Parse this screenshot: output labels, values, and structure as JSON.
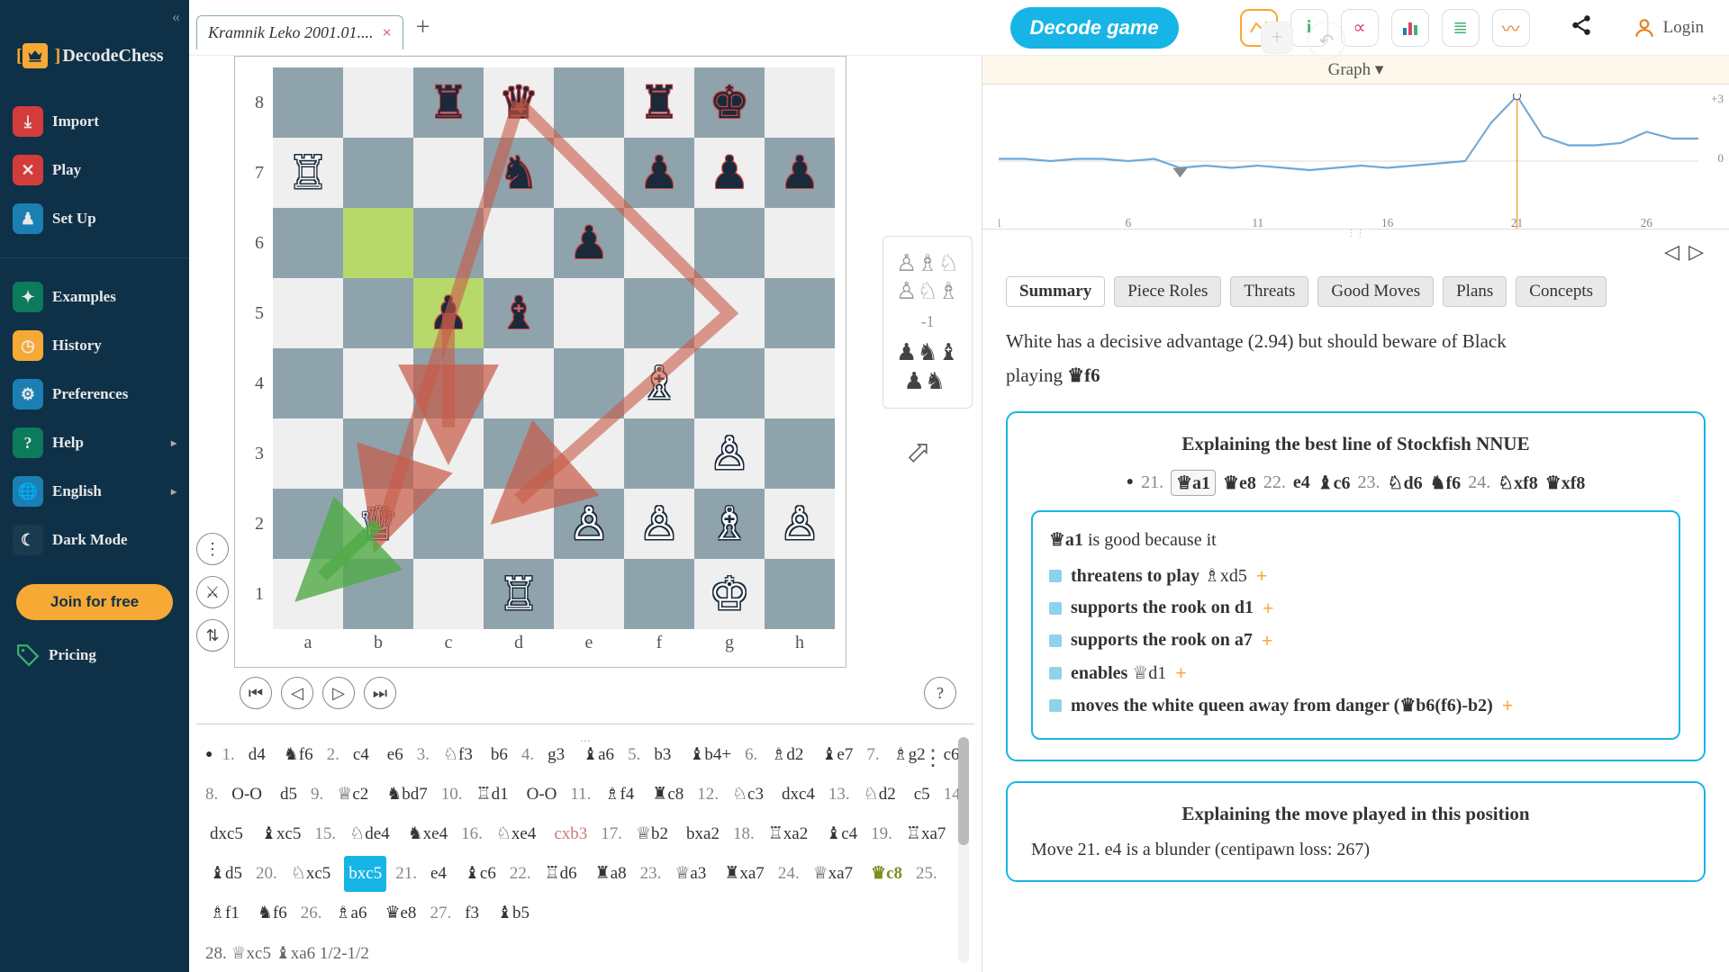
{
  "brand": "DecodeChess",
  "sidebar": {
    "import": "Import",
    "play": "Play",
    "setup": "Set Up",
    "examples": "Examples",
    "history": "History",
    "preferences": "Preferences",
    "help": "Help",
    "language": "English",
    "darkmode": "Dark Mode",
    "join": "Join for free",
    "pricing": "Pricing"
  },
  "tab_title": "Kramnik Leko 2001.01....",
  "decode_label": "Decode game",
  "login_label": "Login",
  "captured_score": "-1",
  "graph": {
    "title": "Graph ▾"
  },
  "chart_data": {
    "type": "line",
    "xlabel": "",
    "ylabel": "",
    "x_ticks": [
      "1",
      "6",
      "11",
      "16",
      "21",
      "26"
    ],
    "ylim": [
      -3,
      3
    ],
    "x": [
      1,
      2,
      3,
      4,
      5,
      6,
      7,
      8,
      9,
      10,
      11,
      12,
      13,
      14,
      15,
      16,
      17,
      18,
      19,
      20,
      21,
      22,
      23,
      24,
      25,
      26,
      27,
      28
    ],
    "values": [
      0.1,
      0.1,
      0.0,
      0.1,
      0.1,
      0.0,
      0.1,
      -0.3,
      -0.2,
      -0.3,
      -0.2,
      -0.3,
      -0.4,
      -0.3,
      -0.2,
      -0.3,
      -0.2,
      -0.1,
      0.0,
      1.7,
      2.9,
      1.1,
      0.7,
      0.7,
      0.8,
      1.3,
      1.0,
      1.0
    ],
    "marker_x": 21,
    "marker_y": 2.9
  },
  "tabs": [
    "Summary",
    "Piece Roles",
    "Threats",
    "Good Moves",
    "Plans",
    "Concepts"
  ],
  "summary_line1": "White has a decisive advantage (2.94) but should beware of Black",
  "summary_line2_a": "playing ",
  "summary_line2_b": "♛f6",
  "best_card_title": "Explaining the best line of Stockfish NNUE",
  "bestline": [
    {
      "n": "21.",
      "m": "♕a1",
      "boxed": true
    },
    {
      "m": "♛e8"
    },
    {
      "n": "22.",
      "m": "e4"
    },
    {
      "m": "♝c6"
    },
    {
      "n": "23.",
      "m": "♘d6"
    },
    {
      "m": "♞f6"
    },
    {
      "n": "24.",
      "m": "♘xf8"
    },
    {
      "m": "♛xf8"
    }
  ],
  "reason_head_a": "♕a1",
  "reason_head_b": " is good because it",
  "reasons": [
    {
      "t": "threatens to play ",
      "m": "♗xd5"
    },
    {
      "t": "supports the rook on d1",
      "m": ""
    },
    {
      "t": "supports the rook on a7",
      "m": ""
    },
    {
      "t": "enables ",
      "m": "♕d1"
    },
    {
      "t": "moves the white queen away from danger (♛b6(f6)-b2)",
      "m": ""
    }
  ],
  "played_card_title": "Explaining the move played in this position",
  "played_text": "Move 21.  e4  is a blunder (centipawn loss: 267)",
  "board_fen_note": "position after 20...bxc5",
  "moves": [
    {
      "n": "1.",
      "w": "d4",
      "b": "♞f6"
    },
    {
      "n": "2.",
      "w": "c4",
      "b": "e6"
    },
    {
      "n": "3.",
      "w": "♘f3",
      "b": "b6"
    },
    {
      "n": "4.",
      "w": "g3",
      "b": "♝a6"
    },
    {
      "n": "5.",
      "w": "b3",
      "b": "♝b4+"
    },
    {
      "n": "6.",
      "w": "♗d2",
      "b": "♝e7"
    },
    {
      "n": "7.",
      "w": "♗g2",
      "b": "c6"
    },
    {
      "n": "8.",
      "w": "O-O",
      "b": "d5"
    },
    {
      "n": "9.",
      "w": "♕c2",
      "b": "♞bd7"
    },
    {
      "n": "10.",
      "w": "♖d1",
      "b": "O-O"
    },
    {
      "n": "11.",
      "w": "♗f4",
      "b": "♜c8"
    },
    {
      "n": "12.",
      "w": "♘c3",
      "b": "dxc4"
    },
    {
      "n": "13.",
      "w": "♘d2",
      "b": "c5"
    },
    {
      "n": "14.",
      "w": "dxc5",
      "b": "♝xc5"
    },
    {
      "n": "15.",
      "w": "♘de4",
      "b": "♞xe4"
    },
    {
      "n": "16.",
      "w": "♘xe4",
      "b": "cxb3",
      "b_cls": "book"
    },
    {
      "n": "17.",
      "w": "♕b2",
      "b": "bxa2"
    },
    {
      "n": "18.",
      "w": "♖xa2",
      "b": "♝c4"
    },
    {
      "n": "19.",
      "w": "♖xa7",
      "b": "♝d5"
    },
    {
      "n": "20.",
      "w": "♘xc5",
      "b": "bxc5",
      "b_cls": "curr"
    },
    {
      "n": "21.",
      "w": "e4",
      "b": "♝c6"
    },
    {
      "n": "22.",
      "w": "♖d6",
      "b": "♜a8"
    },
    {
      "n": "23.",
      "w": "♕a3",
      "b": "♜xa7"
    },
    {
      "n": "24.",
      "w": "♕xa7",
      "b": "♛c8",
      "b_cls": "best"
    },
    {
      "n": "25.",
      "w": "♗f1",
      "b": "♞f6"
    },
    {
      "n": "26.",
      "w": "♗a6",
      "b": "♛e8"
    },
    {
      "n": "27.",
      "w": "f3",
      "b": "♝b5"
    }
  ],
  "moves_tail": "28.   ♕xc5   ♝xa6   1/2-1/2"
}
